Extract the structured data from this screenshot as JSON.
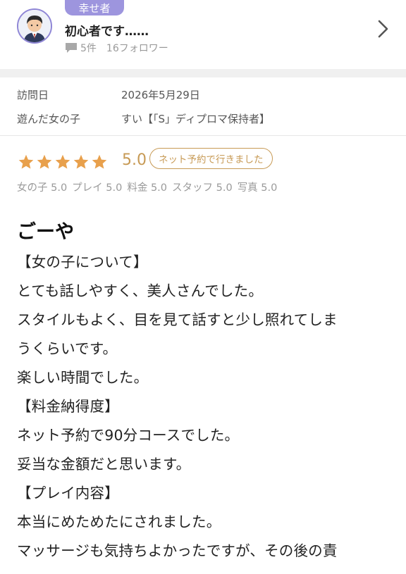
{
  "profile": {
    "badge": "幸せ者",
    "username": "初心者です……",
    "stats_count": "5件",
    "stats_followers": "16フォロワー"
  },
  "visit": {
    "date_label": "訪問日",
    "date_value": "2026年5月29日",
    "girl_label": "遊んだ女の子",
    "girl_value": "すい【「S」ディプロマ保持者】"
  },
  "rating": {
    "stars": 5,
    "score": "5.0",
    "reservation": "ネット予約で行きました",
    "subscores": [
      "女の子 5.0",
      "プレイ 5.0",
      "料金 5.0",
      "スタッフ 5.0",
      "写真 5.0"
    ]
  },
  "review": {
    "title": "ごーや",
    "lines": [
      "【女の子について】",
      "とても話しやすく、美人さんでした。",
      "スタイルもよく、目を見て話すと少し照れてしま",
      "うくらいです。",
      "楽しい時間でした。",
      "【料金納得度】",
      "ネット予約で90分コースでした。",
      "妥当な金額だと思います。",
      "【プレイ内容】",
      "本当にめためたにされました。",
      "マッサージも気持ちよかったですが、その後の責"
    ]
  },
  "colors": {
    "accent_gold": "#c79a55",
    "badge_purple": "#9d95de"
  },
  "icons": [
    "comment-icon",
    "chevron-right-icon",
    "star-icon",
    "avatar"
  ]
}
